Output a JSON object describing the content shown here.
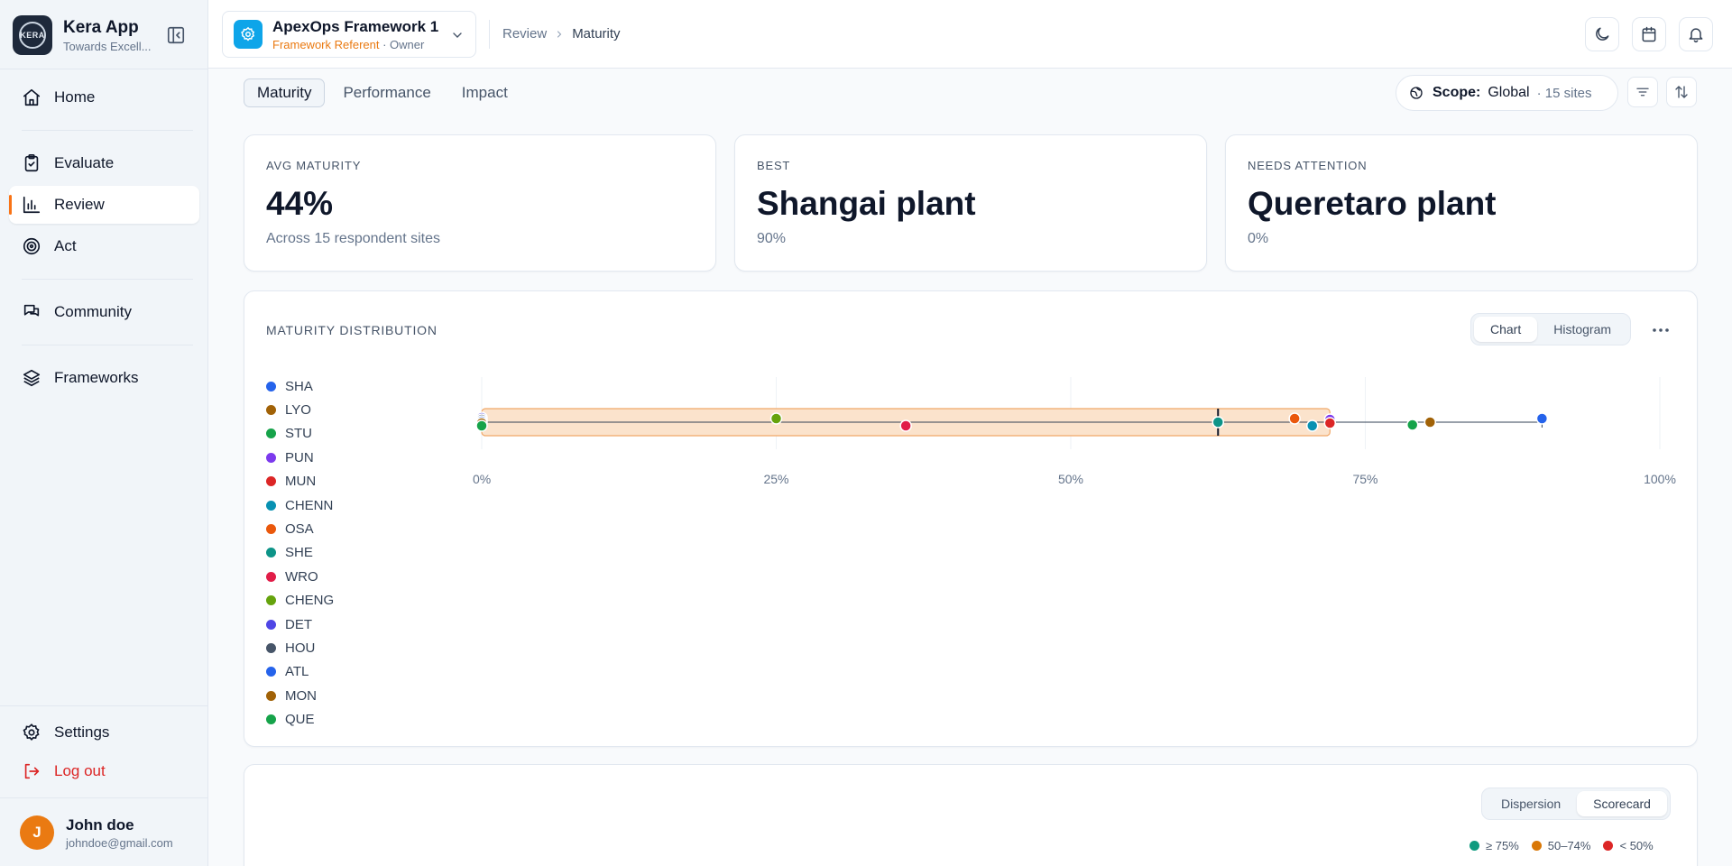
{
  "app": {
    "name": "Kera App",
    "tagline": "Towards Excell...",
    "logo_text": "KERA"
  },
  "nav": {
    "home": "Home",
    "evaluate": "Evaluate",
    "review": "Review",
    "act": "Act",
    "community": "Community",
    "frameworks": "Frameworks",
    "settings": "Settings",
    "logout": "Log out"
  },
  "user": {
    "initial": "J",
    "name": "John doe",
    "email": "johndoe@gmail.com"
  },
  "framework": {
    "name": "ApexOps Framework 1",
    "role_highlight": "Framework Referent",
    "role_rest": " · Owner"
  },
  "breadcrumb": {
    "parent": "Review",
    "current": "Maturity"
  },
  "tabs": {
    "maturity": "Maturity",
    "performance": "Performance",
    "impact": "Impact"
  },
  "scope": {
    "label": "Scope:",
    "value": "Global",
    "sites": "· 15 sites"
  },
  "kpis": {
    "avg": {
      "label": "Avg maturity",
      "value": "44%",
      "sub": "Across 15 respondent sites"
    },
    "best": {
      "label": "Best",
      "value": "Shangai plant",
      "sub": "90%"
    },
    "attention": {
      "label": "Needs attention",
      "value": "Queretaro plant",
      "sub": "0%"
    }
  },
  "distribution": {
    "title": "MATURITY DISTRIBUTION",
    "view_chart": "Chart",
    "view_histogram": "Histogram"
  },
  "bottom_card": {
    "view_dispersion": "Dispersion",
    "view_scorecard": "Scorecard",
    "legend": [
      {
        "label": "≥ 75%",
        "color": "#0f9b7f"
      },
      {
        "label": "50–74%",
        "color": "#d97706"
      },
      {
        "label": "< 50%",
        "color": "#dc2626"
      }
    ]
  },
  "colors": {
    "accent": "#f97316",
    "box_fill": "#fbe3cc",
    "box_stroke": "#f0a868",
    "line": "#334155"
  },
  "chart_data": {
    "type": "scatter",
    "x_axis": {
      "min": 0,
      "max": 100,
      "ticks": [
        "0%",
        "25%",
        "50%",
        "75%",
        "100%"
      ],
      "tick_values": [
        0,
        25,
        50,
        75,
        100
      ]
    },
    "box": {
      "q1": 0,
      "median": 62.5,
      "q3": 72,
      "whisker_min": 0,
      "whisker_max": 90
    },
    "series": [
      {
        "name": "SHA",
        "color": "#2563eb",
        "value": 90
      },
      {
        "name": "LYO",
        "color": "#a16207",
        "value": 80.5
      },
      {
        "name": "STU",
        "color": "#16a34a",
        "value": 79
      },
      {
        "name": "PUN",
        "color": "#7c3aed",
        "value": 72
      },
      {
        "name": "MUN",
        "color": "#dc2626",
        "value": 72
      },
      {
        "name": "CHENN",
        "color": "#0891b2",
        "value": 70.5
      },
      {
        "name": "OSA",
        "color": "#ea580c",
        "value": 69
      },
      {
        "name": "SHE",
        "color": "#0d9488",
        "value": 62.5
      },
      {
        "name": "WRO",
        "color": "#e11d48",
        "value": 36
      },
      {
        "name": "CHENG",
        "color": "#65a30d",
        "value": 25
      },
      {
        "name": "DET",
        "color": "#4f46e5",
        "value": 0
      },
      {
        "name": "HOU",
        "color": "#475569",
        "value": 0
      },
      {
        "name": "ATL",
        "color": "#2563eb",
        "value": 0
      },
      {
        "name": "MON",
        "color": "#a16207",
        "value": 0
      },
      {
        "name": "QUE",
        "color": "#16a34a",
        "value": 0
      }
    ]
  }
}
